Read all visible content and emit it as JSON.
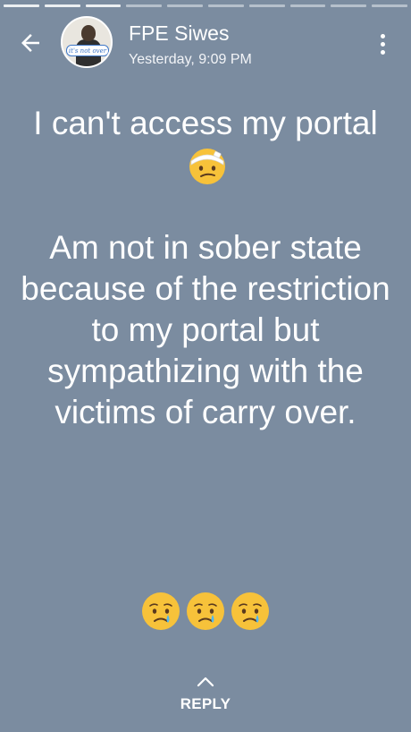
{
  "header": {
    "back_icon": "arrow-left-icon",
    "avatar_caption": "it's not over",
    "name": "FPE Siwes",
    "timestamp": "Yesterday, 9:09 PM",
    "menu_icon": "more-vertical-icon"
  },
  "status": {
    "text_line_1": "I can't access my portal",
    "text_rest": "\n\nAm not in sober state because of the restriction to my portal but sympathizing with the victims of carry over.",
    "inline_emoji": "face-with-head-bandage-emoji",
    "trailing_emojis": [
      "crying-face-emoji",
      "crying-face-emoji",
      "crying-face-emoji"
    ]
  },
  "footer": {
    "reply_label": "REPLY",
    "reply_icon": "chevron-up-icon"
  },
  "colors": {
    "background": "#7b8ca0",
    "text": "#ffffff",
    "emoji_face": "#f7c23a"
  }
}
